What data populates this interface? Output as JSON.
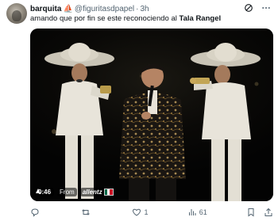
{
  "tweet": {
    "display_name": "barquita",
    "name_emoji": "⛵",
    "handle": "@figuritasdpapel",
    "separator": "·",
    "time": "3h",
    "text_prefix": "amando que por fin se este reconociendo al ",
    "text_bold": "Tala Rangel"
  },
  "media": {
    "duration": "0:46",
    "from_label": "From",
    "source_name": "allentz",
    "source_flag_colors": [
      "#006847",
      "#ffffff",
      "#ce1126"
    ]
  },
  "actions": {
    "reply_count": "",
    "retweet_count": "",
    "like_count": "1",
    "views_count": "61"
  },
  "icons": {
    "header": [
      "grok-icon",
      "more-icon"
    ],
    "actions": [
      "reply-icon",
      "retweet-icon",
      "like-icon",
      "views-icon",
      "bookmark-icon",
      "share-icon"
    ]
  }
}
